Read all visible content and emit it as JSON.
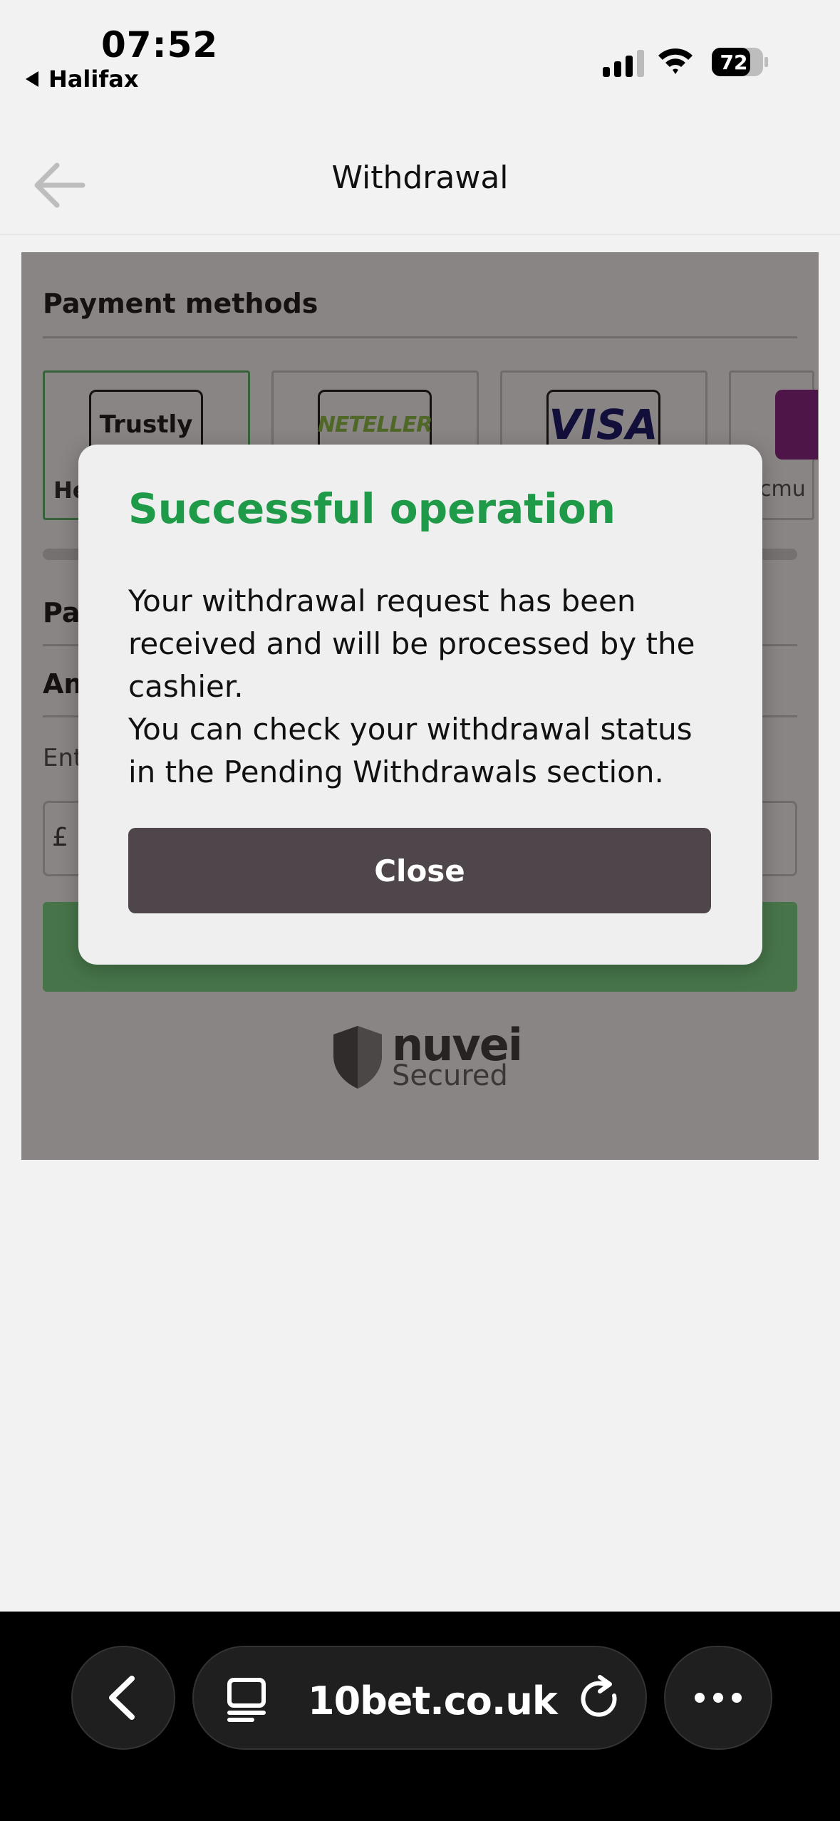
{
  "status_bar": {
    "time": "07:52",
    "back_app": "Halifax",
    "battery": "72"
  },
  "header": {
    "title": "Withdrawal"
  },
  "cashier": {
    "payment_methods_title": "Payment methods",
    "methods": [
      {
        "logo": "Trustly",
        "label": "He",
        "selected": true
      },
      {
        "logo": "NETELLER",
        "label": "",
        "selected": false
      },
      {
        "logo": "VISA",
        "label": "",
        "selected": false
      },
      {
        "logo": "",
        "label": "cmu",
        "selected": false
      }
    ],
    "section_pa": "Pa",
    "section_am": "Am",
    "enter_label": "Ent",
    "currency": "£",
    "brand_word": "nuvei",
    "brand_sub": "Secured"
  },
  "modal": {
    "title": "Successful operation",
    "body_line1": "Your withdrawal request has been received and will be processed by the cashier.",
    "body_line2": "You can check your withdrawal status in the Pending Withdrawals section.",
    "close_label": "Close"
  },
  "browser": {
    "url": "10bet.co.uk"
  }
}
